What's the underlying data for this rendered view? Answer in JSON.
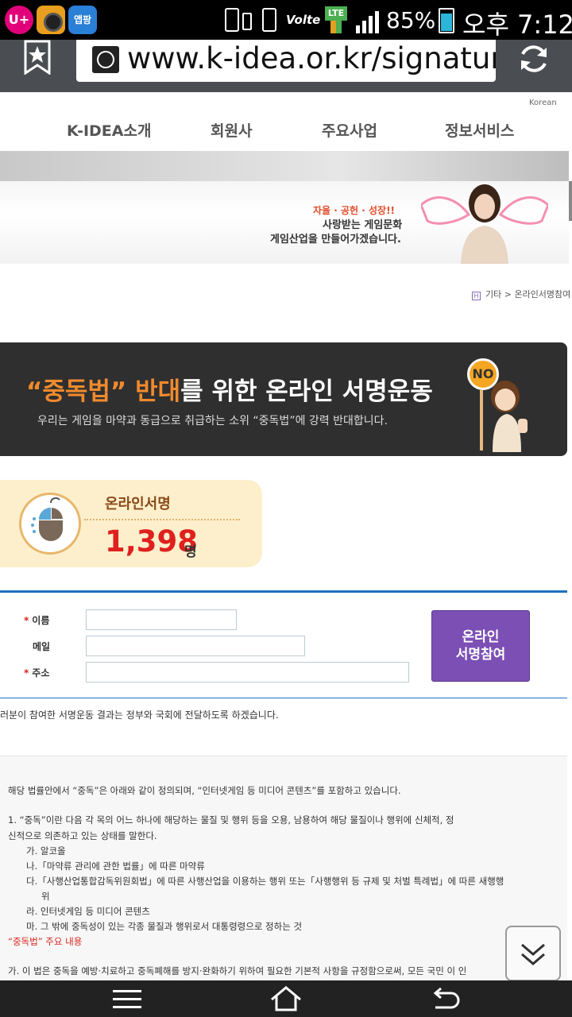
{
  "status_bar": {
    "app1": "U+",
    "app3": "앱팡",
    "volte": "Volte",
    "lte": "LTE",
    "battery": "85%",
    "time": "오후 7:12",
    "icons": [
      "uplus-app-icon",
      "camera-app-icon",
      "apppang-app-icon",
      "screen-mirror-icon",
      "vibrate-icon",
      "volte-icon",
      "lte-icon",
      "signal-icon",
      "battery-icon"
    ]
  },
  "browser": {
    "url": "www.k-idea.or.kr/signatur",
    "icons": [
      "bookmark-star-icon",
      "globe-icon",
      "refresh-icon"
    ]
  },
  "site": {
    "lang": "Korean",
    "nav": [
      "K-IDEA소개",
      "회원사",
      "주요사업",
      "정보서비스"
    ],
    "banner": {
      "line1": "자율 · 공헌 · 성장!!",
      "line2": "사랑받는 게임문화",
      "line3": "게임산업을 만들어가겠습니다."
    },
    "breadcrumb": {
      "home_icon": "H",
      "text": "기타 > 온라인서명참여"
    }
  },
  "campaign": {
    "title_part1": "“중독법” 반대",
    "title_part2": "를 위한 온라인 서명운동",
    "subtitle": "우리는 게임을 마약과 동급으로 취급하는 소위 “중독법”에 강력 반대합니다.",
    "sign": "NO"
  },
  "counter": {
    "label": "온라인서명",
    "value": "1,398",
    "unit": "명"
  },
  "form": {
    "required_mark": "*",
    "name_label": "이름",
    "email_label": "메일",
    "address_label": "주소",
    "name_value": "",
    "email_value": "",
    "address_value": "",
    "submit_label": "온라인\n서명참여",
    "note": "러분이 참여한 서명운동 결과는 정부와 국회에 전달하도록 하겠습니다."
  },
  "definition": {
    "intro": "해당 법률안에서 “중독”은 아래와 같이 정의되며, “인터넷게임 등 미디어 콘텐츠”를 포함하고 있습니다.",
    "item1_a": "1. “중독”이란 다음 각 목의 어느 하나에 해당하는 물질 및 행위 등을 오용, 남용하여 해당 물질이나 행위에 신체적, 정",
    "item1_b": "신적으로 의존하고 있는 상태를 말한다.",
    "sub_ga": "가. 알코올",
    "sub_na": "나.「마약류 관리에 관한 법률」에 따른 마약류",
    "sub_da_a": "다.「사행산업통합감독위원회법」에 따른 사행산업을 이용하는 행위 또는「사행행위 등 규제 및 처벌 특례법」에 따른 새행행",
    "sub_da_b": "위",
    "sub_ra": "라. 인터넷게임 등 미디어 콘텐츠",
    "sub_ma": "마. 그 밖에 중독성이 있는 각종 물질과 행위로서 대통령령으로 정하는 것",
    "heading_red": "“중독법”",
    "heading_rest": " 주요 내용",
    "para_ga": "가. 이 법은 중독을 예방·치료하고 중독폐해를 방지·완화하기 위하여 필요한 기본적 사항을 규정함으로써, 모든 국민 이 인"
  },
  "colors": {
    "accent_orange": "#f08a2d",
    "counter_red": "#e0201f",
    "submit_purple": "#7c4fb5",
    "rule_blue": "#1f6fc0"
  }
}
